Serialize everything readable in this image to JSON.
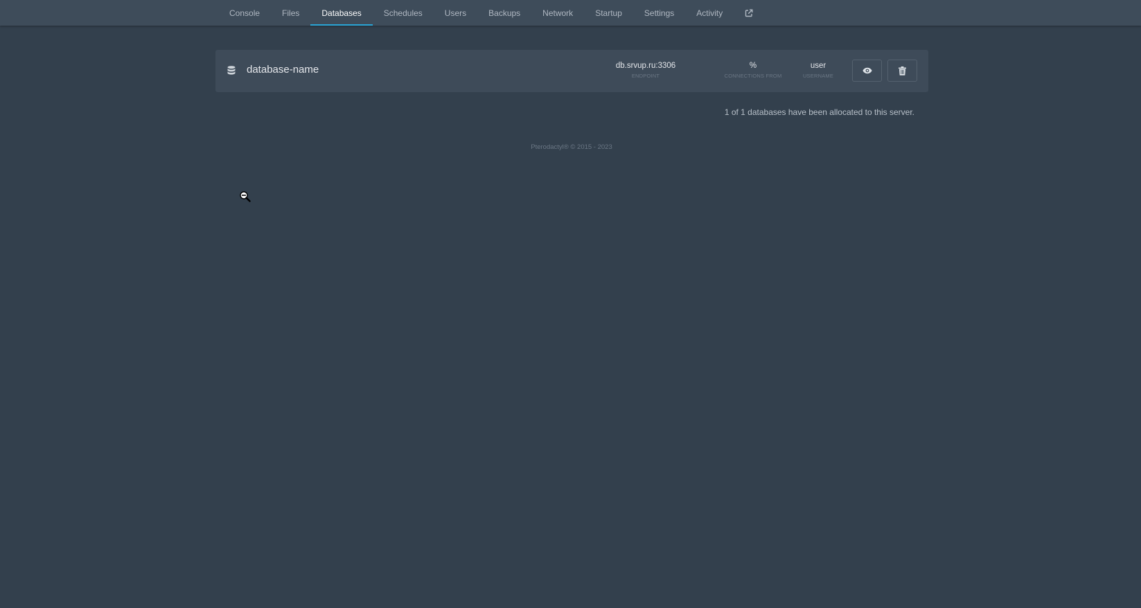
{
  "nav": {
    "tabs": [
      {
        "label": "Console"
      },
      {
        "label": "Files"
      },
      {
        "label": "Databases"
      },
      {
        "label": "Schedules"
      },
      {
        "label": "Users"
      },
      {
        "label": "Backups"
      },
      {
        "label": "Network"
      },
      {
        "label": "Startup"
      },
      {
        "label": "Settings"
      },
      {
        "label": "Activity"
      }
    ],
    "active_tab": "Databases",
    "external_icon": "external-link-icon"
  },
  "database": {
    "icon": "database-icon",
    "name": "database-name",
    "endpoint": {
      "value": "db.srvup.ru:3306",
      "label": "ENDPOINT"
    },
    "connections_from": {
      "value": "%",
      "label": "CONNECTIONS FROM"
    },
    "username": {
      "value": "user",
      "label": "USERNAME"
    },
    "view_icon": "eye-icon",
    "delete_icon": "trash-icon"
  },
  "allocation_text": "1 of 1 databases have been allocated to this server.",
  "footer": "Pterodactyl® © 2015 - 2023",
  "colors": {
    "background": "#33404d",
    "nav_background": "#3e4c5a",
    "card_background": "#3e4b59",
    "accent": "#2aa5d6"
  },
  "cursor_icon": "zoom-out-cursor-icon"
}
